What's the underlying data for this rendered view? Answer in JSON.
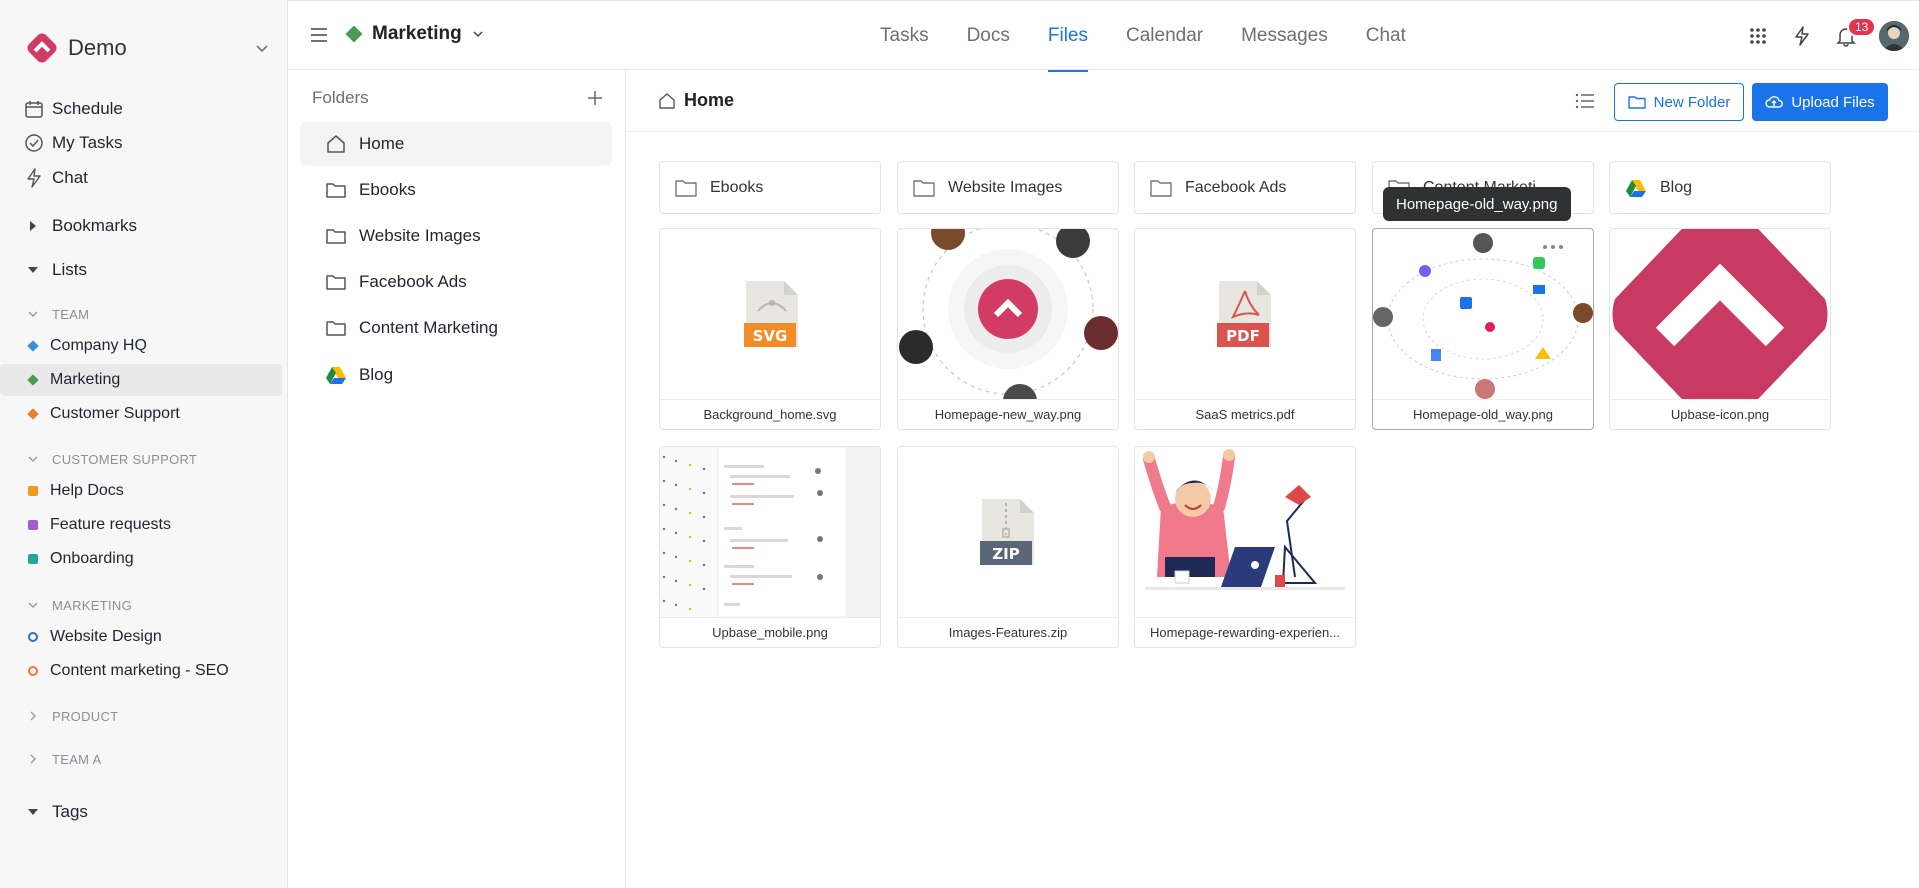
{
  "workspace": {
    "name": "Demo"
  },
  "nav": {
    "schedule": "Schedule",
    "my_tasks": "My Tasks",
    "chat": "Chat"
  },
  "sections": {
    "bookmarks": "Bookmarks",
    "lists": "Lists",
    "tags": "Tags"
  },
  "groups": {
    "team": "TEAM",
    "customer_support": "CUSTOMER SUPPORT",
    "marketing": "MARKETING",
    "product": "PRODUCT",
    "team_a": "TEAM A"
  },
  "lists": {
    "company_hq": "Company HQ",
    "marketing": "Marketing",
    "customer_support": "Customer Support",
    "help_docs": "Help Docs",
    "feature_requests": "Feature requests",
    "onboarding": "Onboarding",
    "website_design": "Website Design",
    "content_seo": "Content marketing - SEO"
  },
  "colors": {
    "brand": "#d23c64",
    "accent": "#1a73e8",
    "company_hq": "#3b8fd6",
    "marketing": "#4a9a54",
    "customer_support": "#f07b2e",
    "help_docs": "#f29a1c",
    "feature_requests": "#a35bd3",
    "onboarding": "#26a69a",
    "website_design": "#2f6fc4",
    "content_seo": "#f07b2e",
    "badge": "#e4334f"
  },
  "topbar": {
    "project": "Marketing",
    "tabs": [
      "Tasks",
      "Docs",
      "Files",
      "Calendar",
      "Messages",
      "Chat"
    ],
    "active_tab": "Files",
    "notifications": "13",
    "icons": [
      "apps-grid-icon",
      "lightning-icon",
      "bell-icon"
    ]
  },
  "folders_panel": {
    "title": "Folders",
    "items": [
      "Home",
      "Ebooks",
      "Website Images",
      "Facebook Ads",
      "Content Marketing",
      "Blog"
    ]
  },
  "main": {
    "breadcrumb": "Home",
    "new_folder": "New Folder",
    "upload_files": "Upload Files",
    "folders": [
      "Ebooks",
      "Website Images",
      "Facebook Ads",
      "Content Marketi...",
      "Blog"
    ],
    "files": [
      {
        "name": "Background_home.svg",
        "type": "SVG"
      },
      {
        "name": "Homepage-new_way.png",
        "type": "image"
      },
      {
        "name": "SaaS metrics.pdf",
        "type": "PDF"
      },
      {
        "name": "Homepage-old_way.png",
        "type": "image"
      },
      {
        "name": "Upbase-icon.png",
        "type": "image"
      },
      {
        "name": "Upbase_mobile.png",
        "type": "image"
      },
      {
        "name": "Images-Features.zip",
        "type": "ZIP"
      },
      {
        "name": "Homepage-rewarding-experien...",
        "type": "image"
      }
    ],
    "tooltip": "Homepage-old_way.png"
  }
}
